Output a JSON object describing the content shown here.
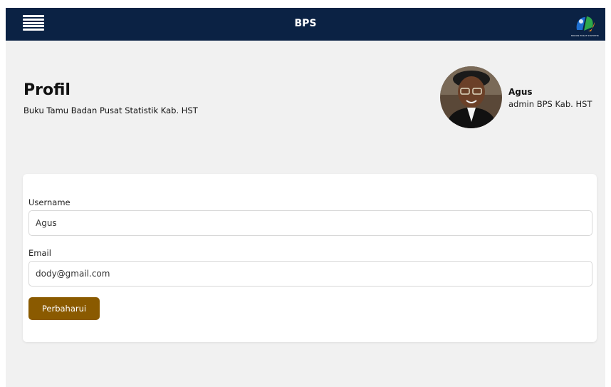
{
  "header": {
    "title": "BPS",
    "logo_caption": "BADAN PUSAT STATISTIK"
  },
  "page": {
    "title": "Profil",
    "subtitle": "Buku Tamu Badan Pusat Statistik Kab. HST"
  },
  "user": {
    "name": "Agus",
    "role": "admin BPS Kab. HST"
  },
  "form": {
    "username_label": "Username",
    "username_value": "Agus",
    "email_label": "Email",
    "email_value": "dody@gmail.com",
    "submit_label": "Perbaharui"
  },
  "colors": {
    "header_bg": "#0b2244",
    "button_bg": "#8a5a00",
    "page_bg": "#f1f1f1"
  },
  "icons": {
    "menu": "hamburger-menu-icon",
    "logo": "bps-logo"
  }
}
